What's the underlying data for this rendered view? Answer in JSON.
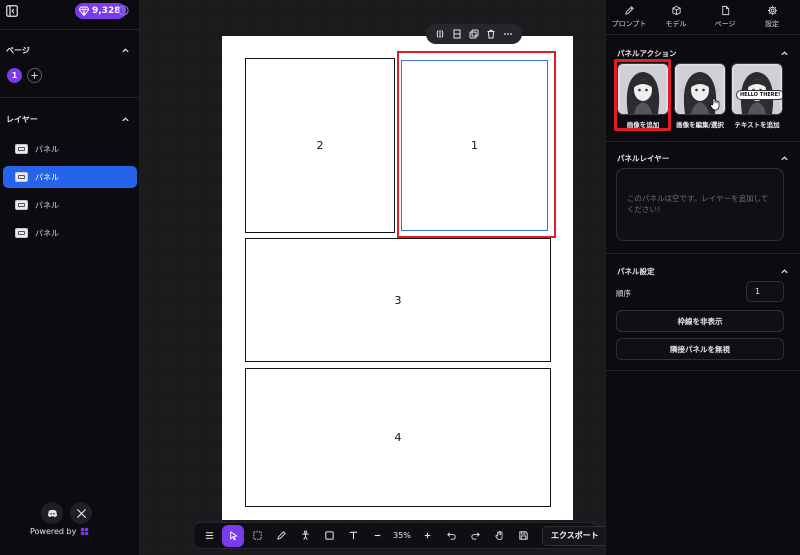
{
  "left_sidebar": {
    "gem_count": "9,328",
    "pages_section": {
      "title": "ページ",
      "current_page": "1"
    },
    "layers_section": {
      "title": "レイヤー",
      "items": [
        {
          "label": "パネル",
          "active": false
        },
        {
          "label": "パネル",
          "active": true
        },
        {
          "label": "パネル",
          "active": false
        },
        {
          "label": "パネル",
          "active": false
        }
      ]
    },
    "footer": {
      "powered_by": "Powered by"
    }
  },
  "canvas": {
    "panels": [
      {
        "number": "2"
      },
      {
        "number": "1",
        "selected": true
      },
      {
        "number": "3"
      },
      {
        "number": "4"
      }
    ]
  },
  "bottom_toolbar": {
    "zoom": "35%",
    "export_label": "エクスポート",
    "active_tool": "select"
  },
  "right_sidebar": {
    "tabs": [
      {
        "label": "プロンプト",
        "icon": "pencil-icon"
      },
      {
        "label": "モデル",
        "icon": "cube-icon"
      },
      {
        "label": "ページ",
        "icon": "file-icon"
      },
      {
        "label": "設定",
        "icon": "gear-icon"
      }
    ],
    "panel_actions": {
      "title": "パネルアクション",
      "cards": [
        {
          "label": "画像を追加"
        },
        {
          "label": "画像を編集/選択"
        },
        {
          "label": "テキストを追加",
          "bubble_text": "HELLO THERE!"
        }
      ]
    },
    "panel_layers": {
      "title": "パネルレイヤー",
      "empty_message": "このパネルは空です。レイヤーを追加してください！"
    },
    "panel_settings": {
      "title": "パネル設定",
      "order_label": "順序",
      "order_value": "1",
      "hide_border_label": "枠線を非表示",
      "ignore_adjacent_label": "隣接パネルを無視"
    }
  },
  "colors": {
    "accent_purple": "#7c3aed",
    "active_blue": "#2563eb",
    "highlight_red": "#e11d27"
  }
}
